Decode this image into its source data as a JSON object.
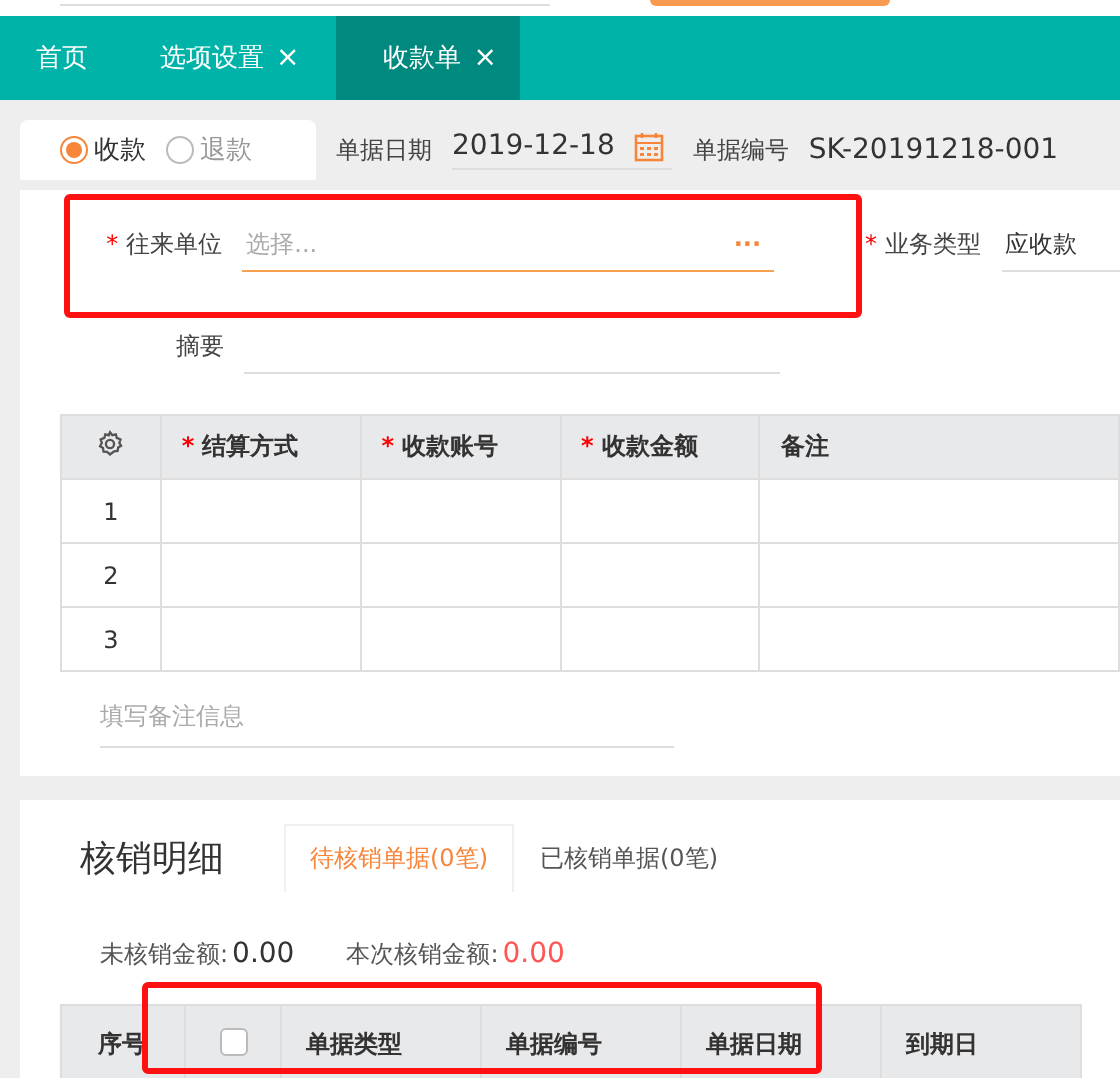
{
  "tabs": [
    {
      "label": "首页",
      "closable": false,
      "selected": false
    },
    {
      "label": "选项设置",
      "closable": true,
      "selected": false
    },
    {
      "label": "收款单",
      "closable": true,
      "selected": true
    }
  ],
  "close_glyph": "×",
  "mode_options": [
    {
      "label": "收款",
      "selected": true
    },
    {
      "label": "退款",
      "selected": false
    }
  ],
  "date": {
    "label": "单据日期",
    "value": "2019-12-18"
  },
  "number": {
    "label": "单据编号",
    "value": "SK-20191218-001"
  },
  "partner": {
    "label": "往来单位",
    "required": true,
    "placeholder": "选择...",
    "more": "···"
  },
  "business_type": {
    "label": "业务类型",
    "required": true,
    "value": "应收款"
  },
  "summary": {
    "label": "摘要"
  },
  "required_mark": "*",
  "table": {
    "columns": [
      {
        "label": "结算方式",
        "required": true
      },
      {
        "label": "收款账号",
        "required": true
      },
      {
        "label": "收款金额",
        "required": true
      },
      {
        "label": "备注",
        "required": false
      }
    ],
    "rows": [
      {
        "index": "1"
      },
      {
        "index": "2"
      },
      {
        "index": "3"
      }
    ]
  },
  "note": {
    "placeholder": "填写备注信息"
  },
  "writeoff": {
    "title": "核销明细",
    "tabs": [
      {
        "label": "待核销单据(0笔)",
        "selected": true
      },
      {
        "label": "已核销单据(0笔)",
        "selected": false
      }
    ],
    "unsettled": {
      "label": "未核销金额:",
      "value": "0.00"
    },
    "current": {
      "label": "本次核销金额:",
      "value": "0.00"
    },
    "columns": [
      {
        "kind": "text",
        "label": "序号"
      },
      {
        "kind": "checkbox",
        "checked": false
      },
      {
        "kind": "text",
        "label": "单据类型"
      },
      {
        "kind": "text",
        "label": "单据编号"
      },
      {
        "kind": "text",
        "label": "单据日期"
      },
      {
        "kind": "text",
        "label": "到期日"
      }
    ]
  }
}
